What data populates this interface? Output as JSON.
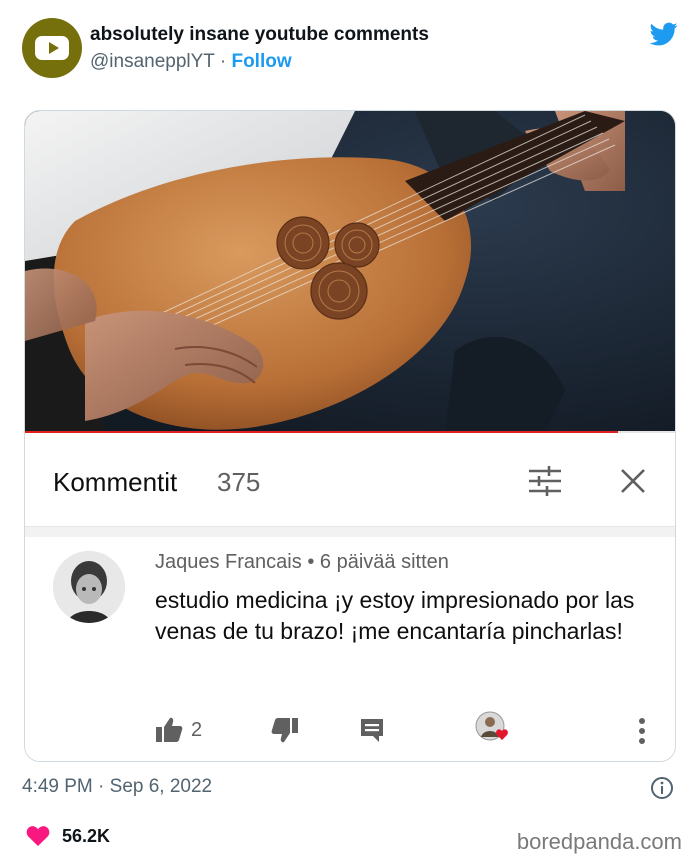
{
  "tweet": {
    "account_name": "absolutely insane youtube comments",
    "handle": "@insanepplYT",
    "separator": "·",
    "follow_label": "Follow",
    "timestamp": "4:49 PM · Sep 6, 2022",
    "likes_count": "56.2K",
    "icons": {
      "avatar": "youtube-play-logo-icon",
      "brand": "twitter-bird-icon",
      "info": "info-icon",
      "likes": "heart-icon"
    },
    "colors": {
      "follow": "#1d9bf0",
      "avatar_bg": "#75700c",
      "heart": "#f91880",
      "twitter_blue": "#1d9bf0"
    }
  },
  "youtube": {
    "video_progress": 0.91,
    "comments_label": "Kommentit",
    "comments_count": "375",
    "icons": {
      "sort": "sort-filter-icon",
      "close": "close-icon"
    },
    "comment": {
      "author": "Jaques Francais",
      "meta_separator": "•",
      "time_ago": "6 päivää sitten",
      "text": "estudio medicina ¡y estoy impresionado por las venas de tu brazo! ¡me encantaría pincharlas!",
      "like_count": "2",
      "icons": {
        "like": "thumbs-up-icon",
        "dislike": "thumbs-down-icon",
        "reply": "reply-comment-icon",
        "creator_heart": "creator-heart-icon",
        "more": "more-vertical-icon"
      }
    },
    "colors": {
      "progress": "#e02020"
    }
  },
  "watermark": "boredpanda.com"
}
